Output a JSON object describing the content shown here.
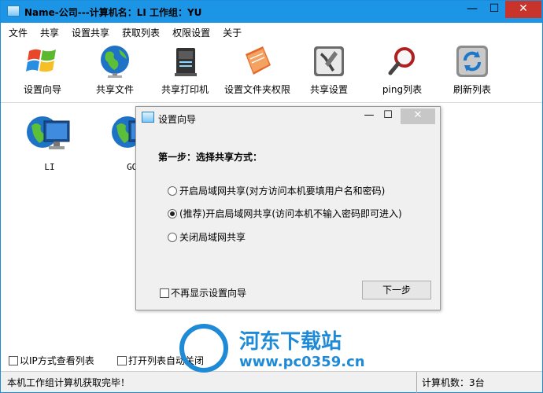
{
  "window": {
    "title": "Name-公司---计算机名：LI  工作组：YU",
    "min_label": "—",
    "max_label": "☐",
    "close_label": "✕"
  },
  "menu": [
    "文件",
    "共享",
    "设置共享",
    "获取列表",
    "权限设置",
    "关于"
  ],
  "toolbar": [
    {
      "label": "设置向导",
      "icon": "windows-logo-icon"
    },
    {
      "label": "共享文件",
      "icon": "globe-icon"
    },
    {
      "label": "共享打印机",
      "icon": "printer-icon"
    },
    {
      "label": "设置文件夹权限",
      "icon": "folder-book-icon"
    },
    {
      "label": "共享设置",
      "icon": "tools-icon"
    },
    {
      "label": "ping列表",
      "icon": "magnifier-icon"
    },
    {
      "label": "刷新列表",
      "icon": "refresh-icon"
    }
  ],
  "hosts": [
    {
      "label": "LI"
    },
    {
      "label": "GOK"
    }
  ],
  "bottom_options": {
    "ip_view": "以IP方式查看列表",
    "auto_close": "打开列表自动关闭"
  },
  "status": {
    "left": "本机工作组计算机获取完毕！",
    "right": "计算机数：3台"
  },
  "dialog": {
    "title": "设置向导",
    "min_label": "—",
    "max_label": "☐",
    "close_label": "✕",
    "step_title": "第一步：选择共享方式：",
    "options": [
      {
        "label": "开启局域网共享(对方访问本机要填用户名和密码)",
        "selected": false
      },
      {
        "label": "(推荐)开启局域网共享(访问本机不输入密码即可进入)",
        "selected": true
      },
      {
        "label": "关闭局域网共享",
        "selected": false
      }
    ],
    "dont_show_label": "不再显示设置向导",
    "next_label": "下一步"
  },
  "watermark": {
    "name": "河东下载站",
    "url": "www.pc0359.cn"
  }
}
